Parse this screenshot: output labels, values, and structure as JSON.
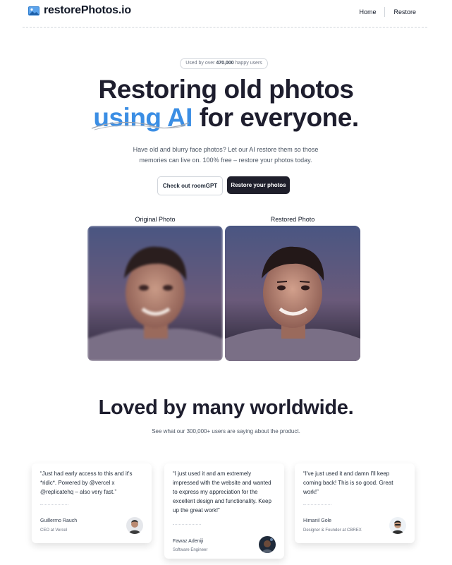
{
  "header": {
    "logo_icon": "photo-icon",
    "logo_text": "restorePhotos.io",
    "nav": [
      {
        "label": "Home"
      },
      {
        "label": "Restore"
      }
    ]
  },
  "hero": {
    "pill_prefix": "Used by over ",
    "pill_count": "470,000",
    "pill_suffix": " happy users",
    "title_line1": "Restoring old photos",
    "title_accent": "using AI",
    "title_rest": " for everyone.",
    "description": "Have old and blurry face photos? Let our AI restore them so those memories can live on. 100% free – restore your photos today.",
    "btn_secondary": "Check out roomGPT",
    "btn_primary": "Restore your photos"
  },
  "comparison": {
    "original_label": "Original Photo",
    "restored_label": "Restored Photo"
  },
  "testimonials": {
    "title": "Loved by many worldwide.",
    "subtitle": "See what our 300,000+ users are saying about the product.",
    "items": [
      {
        "quote": "“Just had early access to this and it's *ridic*. Powered by @vercel x @replicatehq – also very fast.”",
        "name": "Guillermo Rauch",
        "role": "CEO at Vercel"
      },
      {
        "quote": "“I just used it and am extremely impressed with the website and wanted to express my appreciation for the excellent design and functionality. Keep up the great work!”",
        "name": "Fawaz Adeniji",
        "role": "Software Engineer"
      },
      {
        "quote": "“I've just used it and damn I'll keep coming back! This is so good. Great work!”",
        "name": "Himanil Gole",
        "role": "Designer & Founder at CBREX"
      }
    ]
  },
  "colors": {
    "accent": "#3b8ee4",
    "dark_button": "#1f1f2b",
    "text": "#1e1e2e"
  }
}
